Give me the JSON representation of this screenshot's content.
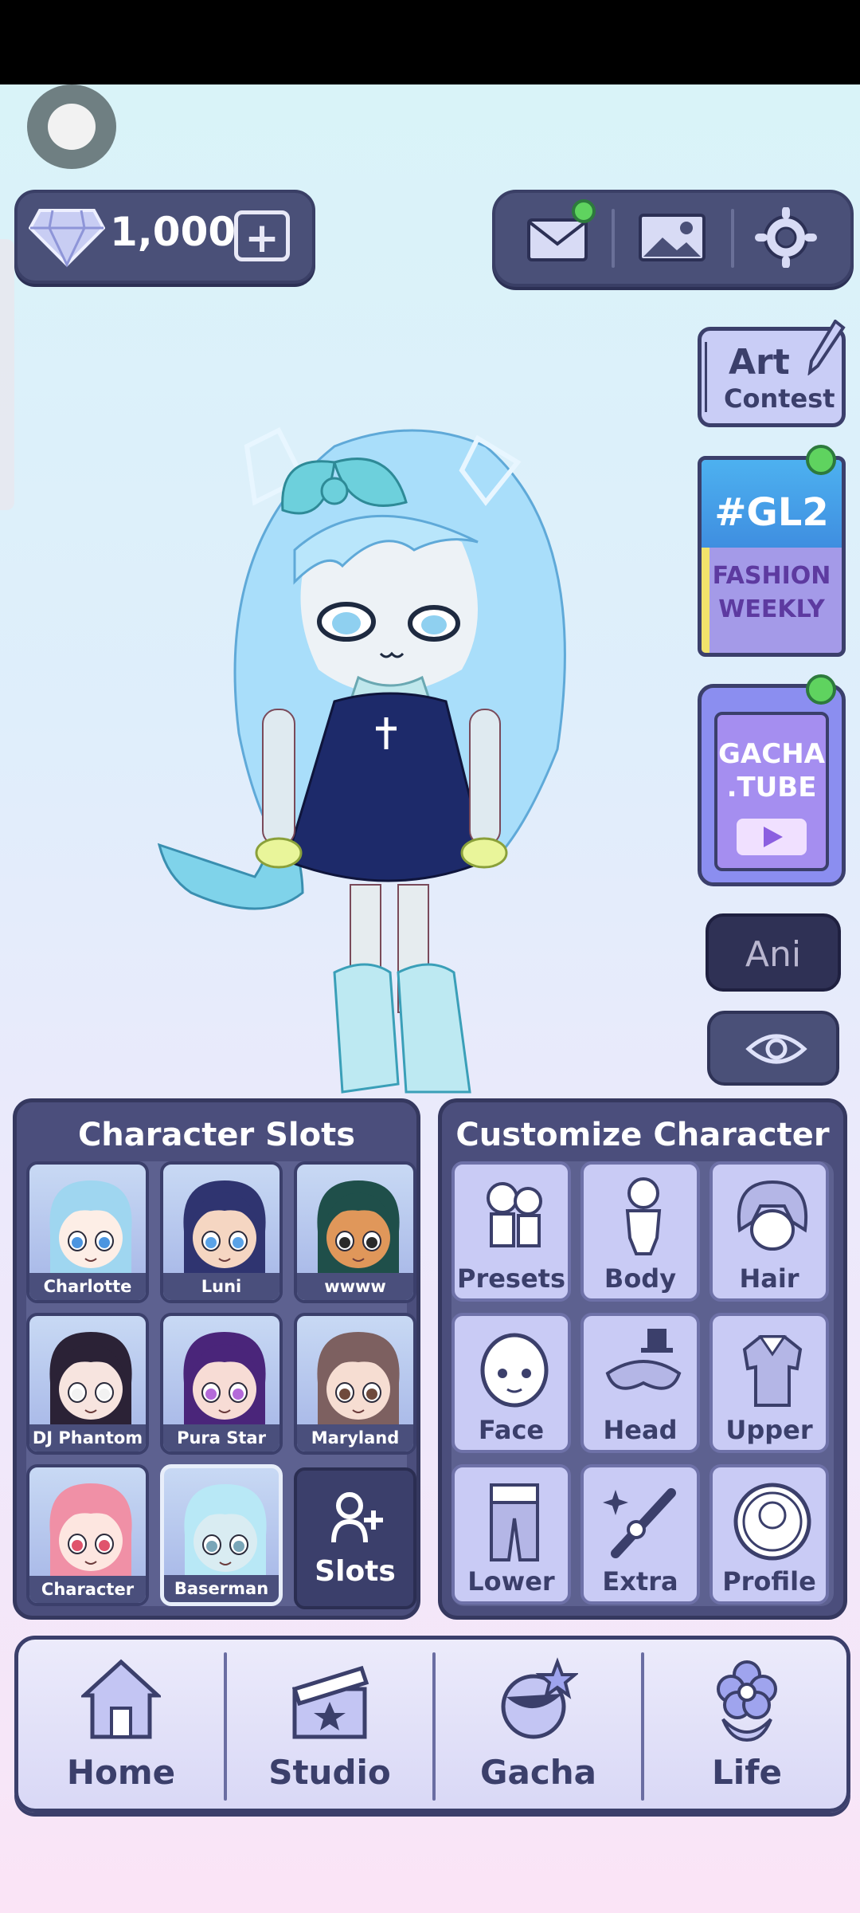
{
  "currency": {
    "gems": "1,000",
    "add_label": "+"
  },
  "top_menu": {
    "mail_notification": true,
    "icons": [
      "mail-icon",
      "gallery-icon",
      "settings-icon"
    ]
  },
  "side_buttons": {
    "art_contest": {
      "line1": "Art",
      "line2": "Contest"
    },
    "gl2": {
      "title": "#GL2",
      "line1": "FASHION",
      "line2": "WEEKLY"
    },
    "gachatube": {
      "line1": "GACHA",
      "line2": ".TUBE"
    },
    "ani": "Ani"
  },
  "character_slots": {
    "title": "Character Slots",
    "slots": [
      {
        "name": "Charlotte",
        "hair": "#9fd6f0",
        "eyes": "#4b95e0",
        "skin": "#fdeee6"
      },
      {
        "name": "Luni",
        "hair": "#2f3470",
        "eyes": "#5aa3e8",
        "skin": "#f5d6c2"
      },
      {
        "name": "wwww",
        "hair": "#1f4f4a",
        "eyes": "#2a2a2a",
        "skin": "#e0975a"
      },
      {
        "name": "DJ Phantom",
        "hair": "#2b2236",
        "eyes": "#f2f2f2",
        "skin": "#f7e4df"
      },
      {
        "name": "Pura Star",
        "hair": "#4a257a",
        "eyes": "#b46ad9",
        "skin": "#f7dcd5"
      },
      {
        "name": "Maryland",
        "hair": "#7d6060",
        "eyes": "#6f4a3c",
        "skin": "#f6ddd2"
      },
      {
        "name": "Character",
        "hair": "#f090a6",
        "eyes": "#e0546c",
        "skin": "#fde6e0"
      },
      {
        "name": "Baserman",
        "hair": "#b8e8f6",
        "eyes": "#7aa6b8",
        "skin": "#d9ecf2"
      }
    ],
    "add_label": "Slots"
  },
  "customize": {
    "title": "Customize Character",
    "items": [
      "Presets",
      "Body",
      "Hair",
      "Face",
      "Head",
      "Upper",
      "Lower",
      "Extra",
      "Profile"
    ]
  },
  "nav": {
    "items": [
      "Home",
      "Studio",
      "Gacha",
      "Life"
    ]
  }
}
